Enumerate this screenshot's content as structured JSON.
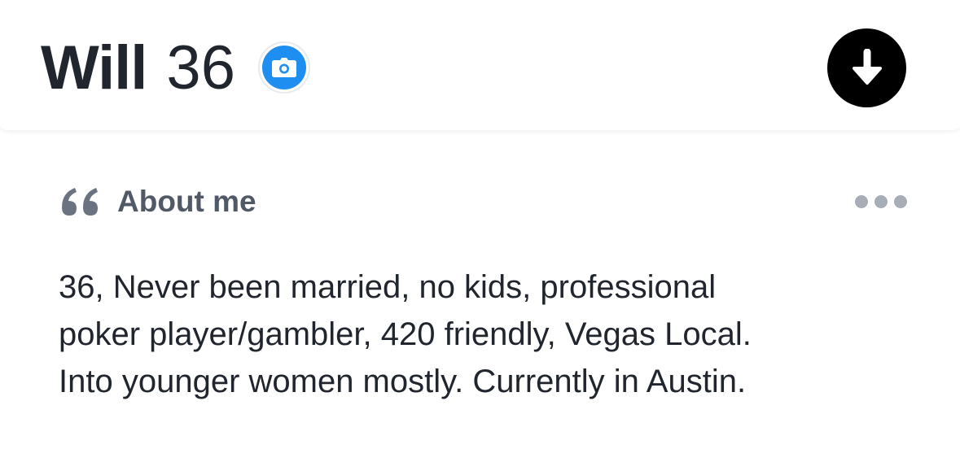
{
  "profile": {
    "name": "Will",
    "age": "36"
  },
  "icons": {
    "verified": "camera-icon",
    "expand": "arrow-down-icon",
    "quote": "quote-icon",
    "more": "more-dots-icon"
  },
  "colors": {
    "verified_badge": "#1f8ef1",
    "text_primary": "#21262e",
    "text_secondary": "#505965"
  },
  "about": {
    "title": "About me",
    "bio_lines": [
      "36,  Never been married, no kids, professional",
      "poker player/gambler, 420 friendly, Vegas Local.",
      "Into younger women mostly. Currently in Austin."
    ]
  }
}
